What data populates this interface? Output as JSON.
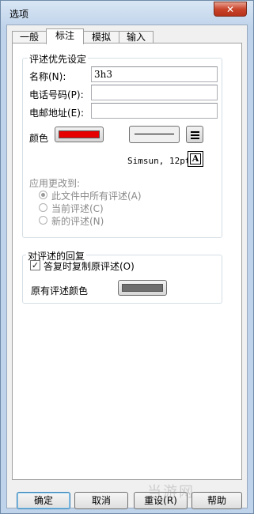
{
  "window": {
    "title": "选项",
    "close_symbol": "✕"
  },
  "tabs": [
    {
      "label": "一般"
    },
    {
      "label": "标注"
    },
    {
      "label": "模拟"
    },
    {
      "label": "输入"
    }
  ],
  "comment_prefs": {
    "legend": "评述优先设定",
    "name_label": "名称(N):",
    "name_value": "3h3",
    "phone_label": "电话号码(P):",
    "phone_value": "",
    "email_label": "电邮地址(E):",
    "email_value": "",
    "color_label": "颜色",
    "color_value": "#e60000",
    "font_text": "Simsun, 12pt",
    "font_icon": "A",
    "apply_label": "应用更改到:",
    "apply_options": [
      {
        "label": "此文件中所有评述(A)",
        "selected": true
      },
      {
        "label": "当前评述(C)",
        "selected": false
      },
      {
        "label": "新的评述(N)",
        "selected": false
      }
    ]
  },
  "reply": {
    "legend": "对评述的回复",
    "copy_label": "答复时复制原评述(O)",
    "copy_checked": true,
    "orig_color_label": "原有评述颜色",
    "orig_color_value": "#6e6e6e"
  },
  "buttons": {
    "ok": "确定",
    "cancel": "取消",
    "reset": "重设(R)",
    "help": "帮助"
  },
  "watermark": "当游网"
}
